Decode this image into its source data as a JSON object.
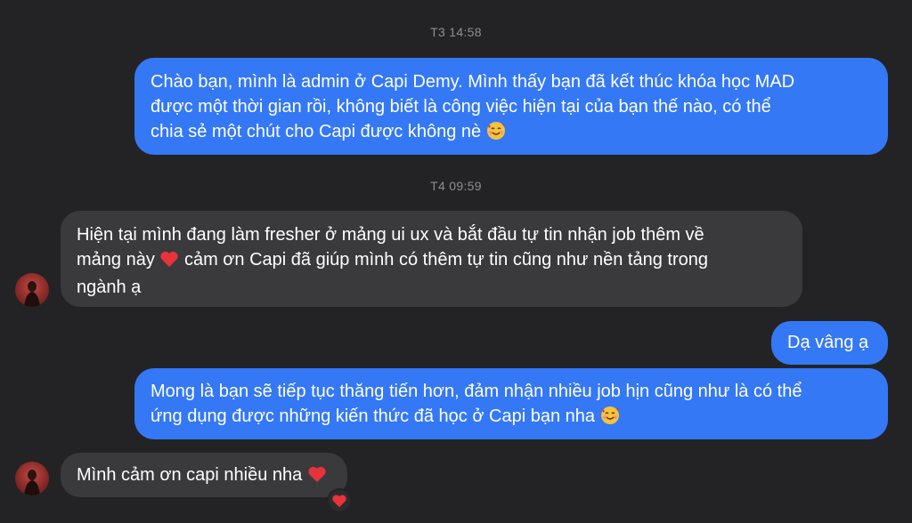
{
  "messages": {
    "ts1": "T3 14:58",
    "m1": "Chào bạn, mình là admin ở Capi Demy. Mình thấy bạn đã kết thúc khóa học MAD\nđược một thời gian rồi, không biết là công việc hiện tại của bạn thế nào, có thể\nchia sẻ một chút cho Capi được không nè",
    "ts2": "T4 09:59",
    "m2_part1": "Hiện tại mình đang làm fresher ở mảng ui ux và bắt đầu tự tin nhận job thêm về\nmảng này",
    "m2_part2": " cảm ơn Capi đã giúp mình có thêm tự tin cũng như nền tảng trong\nngành ạ",
    "m3": "Dạ vâng ạ",
    "m4": "Mong là bạn sẽ tiếp tục thăng tiến hơn, đảm nhận nhiều job hịn cũng như là có thể\nứng dụng được những kiến thức đã học ở Capi bạn nha",
    "m5": "Mình cảm ơn capi nhiều nha"
  },
  "icons": {
    "love_emoji": "smiling-face-with-hearts-icon",
    "heart": "red-heart-icon",
    "reaction": "heart-reaction-icon"
  },
  "colors": {
    "background": "#232325",
    "outgoing_bubble": "#3478f6",
    "incoming_bubble": "#3a3a3c",
    "timestamp": "#8e8e93",
    "heart": "#e8323c"
  }
}
